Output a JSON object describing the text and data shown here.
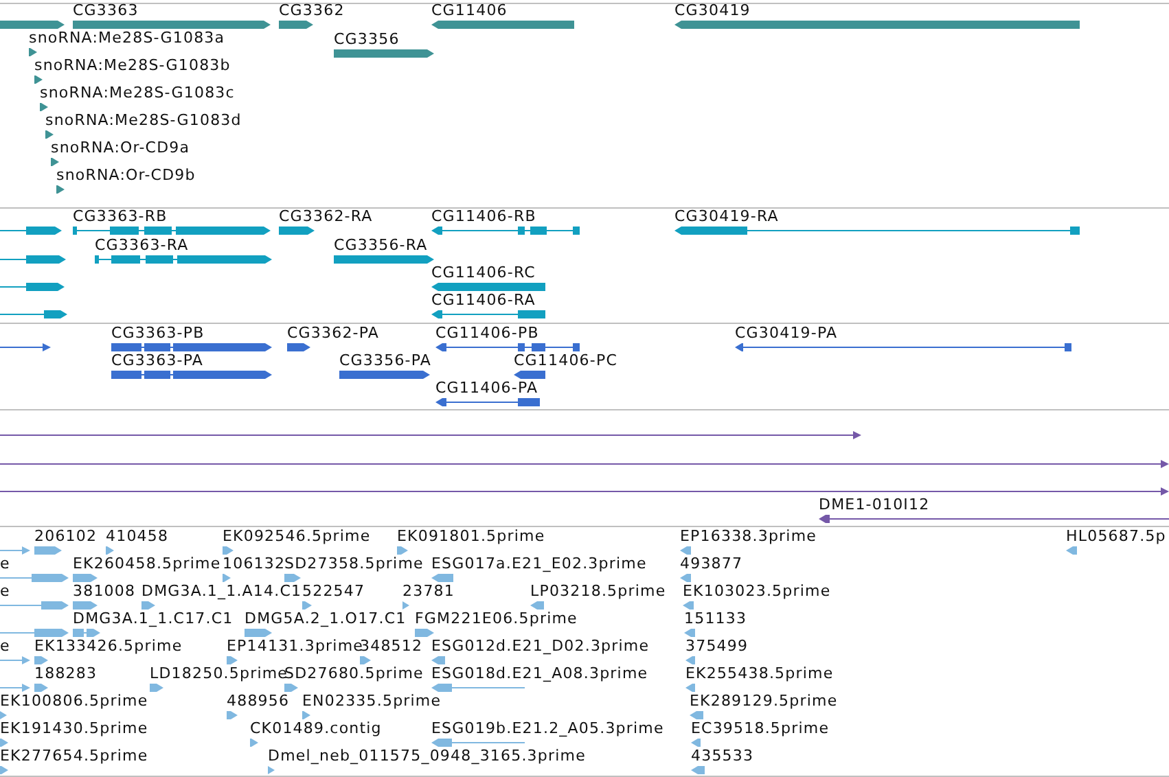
{
  "tracks": [
    {
      "kind": "genes",
      "features": [
        {
          "reverse": false
        },
        {
          "label": "CG3363",
          "reverse": false
        },
        {
          "label": "CG3362",
          "reverse": false
        },
        {
          "label": "CG11406",
          "reverse": true
        },
        {
          "label": "CG30419",
          "reverse": true
        },
        {
          "label": "CG3356",
          "reverse": false
        },
        {
          "label": "snoRNA:Me28S-G1083a",
          "reverse": false
        },
        {
          "label": "snoRNA:Me28S-G1083b",
          "reverse": false
        },
        {
          "label": "snoRNA:Me28S-G1083c",
          "reverse": false
        },
        {
          "label": "snoRNA:Me28S-G1083d",
          "reverse": false
        },
        {
          "label": "snoRNA:Or-CD9a",
          "reverse": false
        },
        {
          "label": "snoRNA:Or-CD9b",
          "reverse": false
        }
      ]
    },
    {
      "kind": "transcripts",
      "features": [
        {
          "reverse": false
        },
        {
          "label": "CG3363-RB",
          "reverse": false
        },
        {
          "label": "CG3362-RA",
          "reverse": false
        },
        {
          "label": "CG11406-RB",
          "reverse": true
        },
        {
          "label": "CG30419-RA",
          "reverse": true
        },
        {
          "reverse": false
        },
        {
          "label": "CG3363-RA",
          "reverse": false
        },
        {
          "label": "CG3356-RA",
          "reverse": false
        },
        {
          "reverse": false
        },
        {
          "label": "CG11406-RC",
          "reverse": true
        },
        {
          "reverse": false
        },
        {
          "label": "CG11406-RA",
          "reverse": true
        }
      ]
    },
    {
      "kind": "proteins",
      "features": [
        {
          "reverse": false
        },
        {
          "label": "CG3363-PB",
          "reverse": false
        },
        {
          "label": "CG3362-PA",
          "reverse": false
        },
        {
          "label": "CG11406-PB",
          "reverse": true
        },
        {
          "label": "CG30419-PA",
          "reverse": true
        },
        {
          "label": "CG3363-PA",
          "reverse": false
        },
        {
          "label": "CG3356-PA",
          "reverse": false
        },
        {
          "label": "CG11406-PC",
          "reverse": true
        },
        {
          "label": "CG11406-PA",
          "reverse": true
        }
      ]
    },
    {
      "kind": "clones",
      "features": [
        {
          "reverse": false
        },
        {
          "reverse": false
        },
        {
          "reverse": false
        },
        {
          "label": "DME1-010I12",
          "reverse": true
        }
      ]
    },
    {
      "kind": "ests",
      "features": [
        {
          "reverse": false
        },
        {
          "label": "206102",
          "reverse": false
        },
        {
          "label": "410458",
          "reverse": false
        },
        {
          "label": "EK092546.5prime",
          "reverse": false
        },
        {
          "label": "EK091801.5prime",
          "reverse": false
        },
        {
          "label": "EP16338.3prime",
          "reverse": true
        },
        {
          "label": "HL05687.5p",
          "reverse": true
        },
        {
          "label": "e",
          "reverse": false
        },
        {
          "label": "EK260458.5prime",
          "reverse": false
        },
        {
          "label": "106132",
          "reverse": false
        },
        {
          "label": "SD27358.5prime",
          "reverse": false
        },
        {
          "label": "ESG017a.E21_E02.3prime",
          "reverse": true
        },
        {
          "label": "493877",
          "reverse": true
        },
        {
          "label": "e",
          "reverse": false
        },
        {
          "label": "381008",
          "reverse": false
        },
        {
          "label": "DMG3A.1_1.A14.C1",
          "reverse": false
        },
        {
          "label": "522547",
          "reverse": false
        },
        {
          "label": "23781",
          "reverse": false
        },
        {
          "label": "LP03218.5prime",
          "reverse": true
        },
        {
          "label": "EK103023.5prime",
          "reverse": true
        },
        {
          "reverse": false
        },
        {
          "label": "DMG3A.1_1.C17.C1",
          "reverse": false
        },
        {
          "label": "DMG5A.2_1.O17.C1",
          "reverse": false
        },
        {
          "label": "FGM221E06.5prime",
          "reverse": false
        },
        {
          "label": "151133",
          "reverse": true
        },
        {
          "label": "e",
          "reverse": false
        },
        {
          "label": "EK133426.5prime",
          "reverse": false
        },
        {
          "label": "EP14131.3prime",
          "reverse": false
        },
        {
          "label": "348512",
          "reverse": false
        },
        {
          "label": "ESG012d.E21_D02.3prime",
          "reverse": true
        },
        {
          "label": "375499",
          "reverse": true
        },
        {
          "reverse": false
        },
        {
          "label": "188283",
          "reverse": false
        },
        {
          "label": "LD18250.5prime",
          "reverse": false
        },
        {
          "label": "SD27680.5prime",
          "reverse": false
        },
        {
          "label": "ESG018d.E21_A08.3prime",
          "reverse": true
        },
        {
          "label": "EK255438.5prime",
          "reverse": true
        },
        {
          "label": "EK100806.5prime",
          "reverse": false
        },
        {
          "label": "488956",
          "reverse": false
        },
        {
          "label": "EN02335.5prime",
          "reverse": false
        },
        {
          "label": "EK289129.5prime",
          "reverse": true
        },
        {
          "label": "EK191430.5prime",
          "reverse": false
        },
        {
          "label": "CK01489.contig",
          "reverse": false
        },
        {
          "label": "ESG019b.E21.2_A05.3prime",
          "reverse": true
        },
        {
          "label": "EC39518.5prime",
          "reverse": true
        },
        {
          "label": "EK277654.5prime",
          "reverse": false
        },
        {
          "label": "Dmel_neb_011575_0948_3165.3prime",
          "reverse": false
        },
        {
          "label": "435533",
          "reverse": true
        }
      ]
    }
  ]
}
